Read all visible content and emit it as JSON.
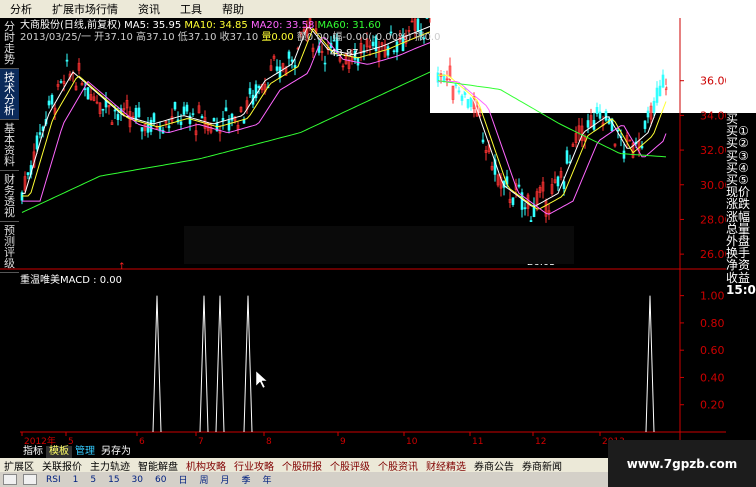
{
  "menubar": [
    "分析",
    "扩展市场行情",
    "资讯",
    "工具",
    "帮助"
  ],
  "side_tabs": [
    {
      "label": "分时走势",
      "active": false
    },
    {
      "label": "技术分析",
      "active": true
    },
    {
      "label": "基本资料",
      "active": false
    },
    {
      "label": "财务透视",
      "active": false
    },
    {
      "label": "预测评级",
      "active": false
    }
  ],
  "info": {
    "stock_name": "大商股份(日线,前复权)",
    "ma5_label": "MA5: 35.95",
    "ma10_label": "MA10: 34.85",
    "ma20_label": "MA20: 33.58",
    "ma60_label": "MA60: 31.60",
    "line2_date_open": "2013/03/25/一 开37.10",
    "line2_high_low": "高37.10 低37.10 收37.10",
    "line2_vol": "量0.00",
    "line2_rest": "额0.00 幅-0.00(-0.00%) 振0.0"
  },
  "chart_data": [
    {
      "type": "candlestick",
      "title": "大商股份(日线,前复权)",
      "y_ticks": [
        26.0,
        28.0,
        30.0,
        32.0,
        34.0,
        36.0
      ],
      "ylim": [
        25.2,
        39.5
      ],
      "annotations": [
        "43.87",
        "26.05"
      ],
      "series": [
        {
          "name": "MA5",
          "value": 35.95,
          "color": "#ffffff"
        },
        {
          "name": "MA10",
          "value": 34.85,
          "color": "#ffff33"
        },
        {
          "name": "MA20",
          "value": 33.58,
          "color": "#ff66ff"
        },
        {
          "name": "MA60",
          "value": 31.6,
          "color": "#33ff33"
        }
      ],
      "x_labels": [
        "2012年",
        "5",
        "6",
        "7",
        "8",
        "9",
        "10",
        "11",
        "12",
        "2013"
      ]
    },
    {
      "type": "bar",
      "title": "重温唯美MACD : 0.00",
      "y_ticks": [
        0.2,
        0.4,
        0.6,
        0.8,
        1.0
      ],
      "ylim": [
        0,
        1.1
      ],
      "spike_positions_approx": [
        157,
        204,
        220,
        248,
        650
      ],
      "values": [
        1.0,
        1.0,
        1.0,
        1.0,
        1.0
      ]
    }
  ],
  "right_panel": [
    "买",
    "买①",
    "买②",
    "买③",
    "买④",
    "买⑤",
    "现价",
    "涨跌",
    "涨幅",
    "总量",
    "外盘",
    "换手",
    "净资",
    "收益",
    "15:0"
  ],
  "bottom_tabs": [
    {
      "label": "指标",
      "state": "normal"
    },
    {
      "label": "模板",
      "state": "active"
    },
    {
      "label": "管理",
      "state": "hl"
    },
    {
      "label": "另存为",
      "state": "normal"
    }
  ],
  "bottom_bar": [
    "扩展区",
    "关联报价",
    "主力轨迹",
    "智能解盘",
    "机构攻略",
    "行业攻略",
    "个股研报",
    "个股评级",
    "个股资讯",
    "财经精选",
    "券商公告",
    "券商新闻"
  ],
  "toolbar": [
    "RSI",
    "1",
    "5",
    "15",
    "30",
    "60",
    "日",
    "周",
    "月",
    "季",
    "年"
  ],
  "watermark": "www.7gpzb.com"
}
